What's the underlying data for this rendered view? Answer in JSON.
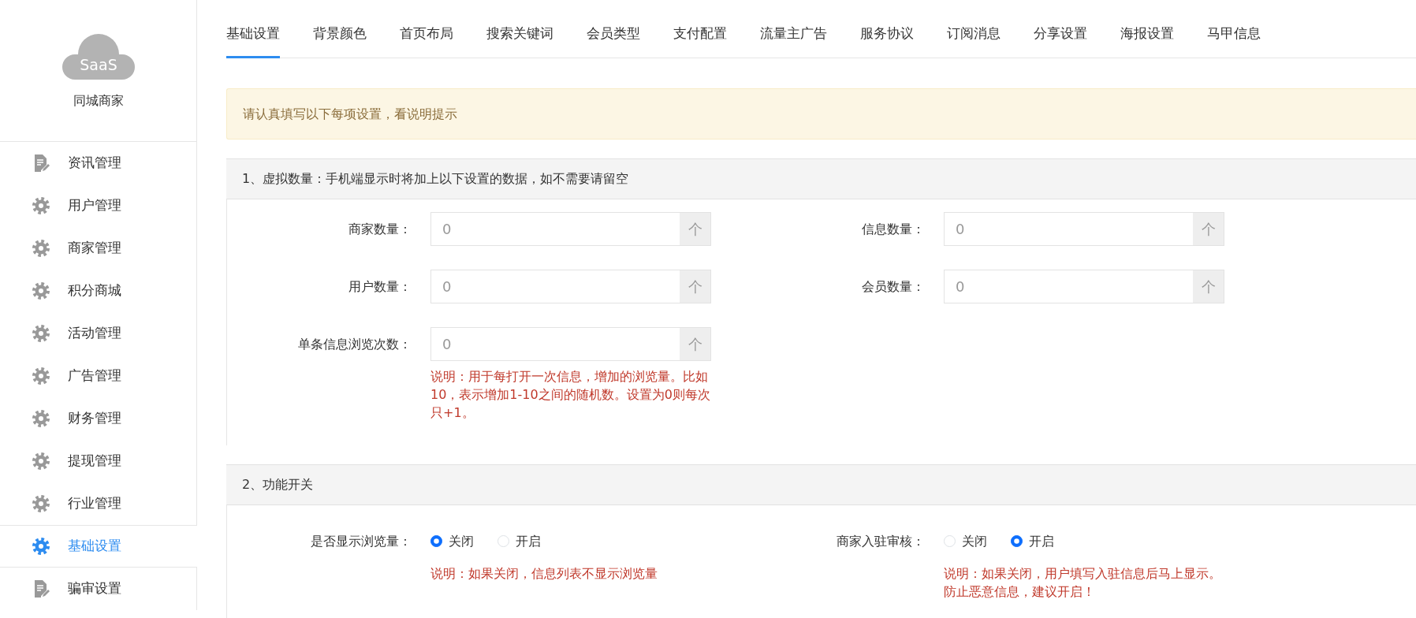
{
  "sidebar": {
    "logo_text": "SaaS",
    "title": "同城商家",
    "items": [
      {
        "label": "资讯管理",
        "kind": "document",
        "selected": false
      },
      {
        "label": "用户管理",
        "kind": "gear",
        "selected": false
      },
      {
        "label": "商家管理",
        "kind": "gear",
        "selected": false
      },
      {
        "label": "积分商城",
        "kind": "gear",
        "selected": false
      },
      {
        "label": "活动管理",
        "kind": "gear",
        "selected": false
      },
      {
        "label": "广告管理",
        "kind": "gear",
        "selected": false
      },
      {
        "label": "财务管理",
        "kind": "gear",
        "selected": false
      },
      {
        "label": "提现管理",
        "kind": "gear",
        "selected": false
      },
      {
        "label": "行业管理",
        "kind": "gear",
        "selected": false
      },
      {
        "label": "基础设置",
        "kind": "gear",
        "selected": true
      },
      {
        "label": "骗审设置",
        "kind": "document",
        "selected": false
      }
    ]
  },
  "tabs": [
    {
      "label": "基础设置",
      "selected": true
    },
    {
      "label": "背景颜色",
      "selected": false
    },
    {
      "label": "首页布局",
      "selected": false
    },
    {
      "label": "搜索关键词",
      "selected": false
    },
    {
      "label": "会员类型",
      "selected": false
    },
    {
      "label": "支付配置",
      "selected": false
    },
    {
      "label": "流量主广告",
      "selected": false
    },
    {
      "label": "服务协议",
      "selected": false
    },
    {
      "label": "订阅消息",
      "selected": false
    },
    {
      "label": "分享设置",
      "selected": false
    },
    {
      "label": "海报设置",
      "selected": false
    },
    {
      "label": "马甲信息",
      "selected": false
    }
  ],
  "alert": "请认真填写以下每项设置，看说明提示",
  "sections": [
    {
      "title": "1、虚拟数量：手机端显示时将加上以下设置的数据，如不需要请留空",
      "fields": [
        {
          "kind": "number",
          "label": "商家数量：",
          "placeholder": "0",
          "addon": "个"
        },
        {
          "kind": "number",
          "label": "信息数量：",
          "placeholder": "0",
          "addon": "个"
        },
        {
          "kind": "number",
          "label": "用户数量：",
          "placeholder": "0",
          "addon": "个"
        },
        {
          "kind": "number",
          "label": "会员数量：",
          "placeholder": "0",
          "addon": "个"
        },
        {
          "kind": "number",
          "label": "单条信息浏览次数：",
          "placeholder": "0",
          "addon": "个",
          "help": "说明：用于每打开一次信息，增加的浏览量。比如10，表示增加1-10之间的随机数。设置为0则每次只+1。"
        }
      ]
    },
    {
      "title": "2、功能开关",
      "fields": [
        {
          "kind": "radio",
          "label": "是否显示浏览量：",
          "options": [
            {
              "label": "关闭",
              "selected": true
            },
            {
              "label": "开启",
              "selected": false
            }
          ],
          "help": "说明：如果关闭，信息列表不显示浏览量"
        },
        {
          "kind": "radio",
          "label": "商家入驻审核：",
          "options": [
            {
              "label": "关闭",
              "selected": false
            },
            {
              "label": "开启",
              "selected": true
            }
          ],
          "help": "说明：如果关闭，用户填写入驻信息后马上显示。防止恶意信息，建议开启！"
        }
      ]
    }
  ]
}
